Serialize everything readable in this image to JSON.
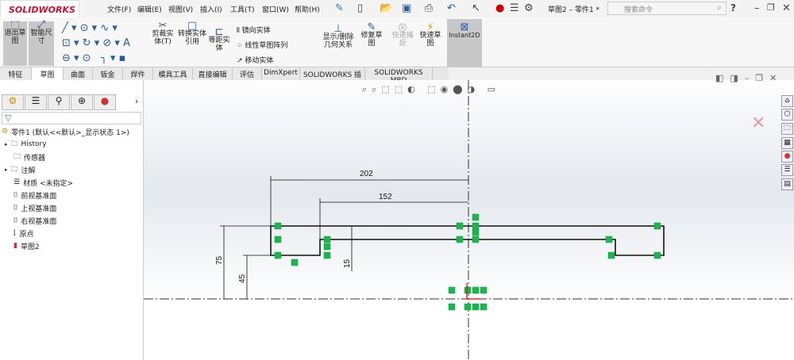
{
  "app": {
    "logo": "SOLIDWORKS",
    "title": "草图2 – 零件1 *",
    "search_placeholder": "搜索命令",
    "help": "?"
  },
  "menu": [
    "文件(F)",
    "编辑(E)",
    "视图(V)",
    "插入(I)",
    "工具(T)",
    "窗口(W)",
    "帮助(H)"
  ],
  "ribbon": {
    "exit_sketch": "退出草图",
    "smart_dim": "智能尺寸",
    "trim": "剪裁实体(T)",
    "convert": "转换实体引用",
    "offset": "等距实体",
    "mirror": "镜向实体",
    "linear_pattern": "线性草图阵列",
    "move": "移动实体",
    "relations": "显示/删除几何关系",
    "repair": "修复草图",
    "quick_snap": "快速捕捉",
    "rapid_sketch": "快速草图",
    "instant2d": "Instant2D"
  },
  "tabs": [
    "特征",
    "草图",
    "曲面",
    "钣金",
    "焊件",
    "模具工具",
    "直接编辑",
    "评估",
    "DimXpert",
    "SOLIDWORKS 插件",
    "SOLIDWORKS MBD"
  ],
  "active_tab": "草图",
  "tree": {
    "root": "零件1  (默认<<默认>_显示状态 1>)",
    "items": [
      "History",
      "传感器",
      "注解",
      "材质 <未指定>",
      "前视基准面",
      "上视基准面",
      "右视基准面",
      "原点",
      "草图2"
    ]
  },
  "dimensions": {
    "d1": "202",
    "d2": "152",
    "d3": "75",
    "d4": "45",
    "d5": "15"
  },
  "colors": {
    "relation": "#22b14c",
    "accent": "#c8102e"
  }
}
